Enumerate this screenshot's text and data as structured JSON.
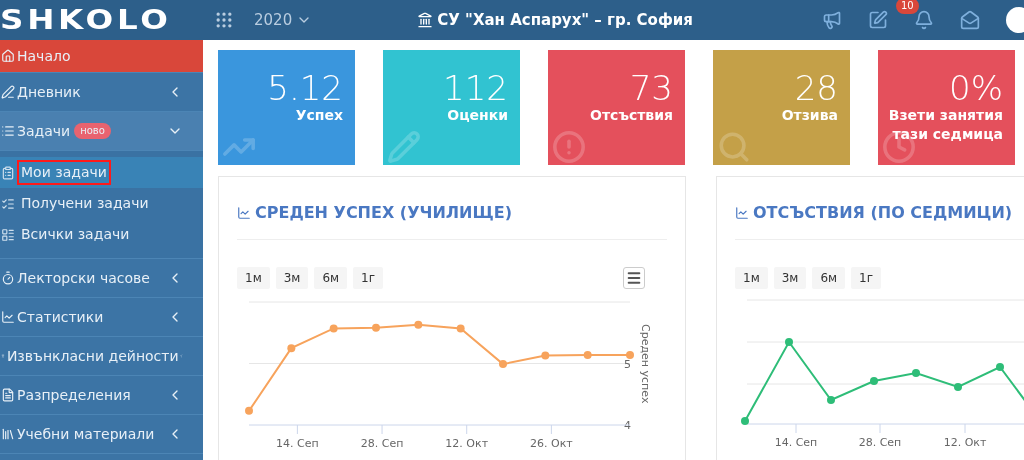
{
  "header": {
    "logo": "SHKOLO",
    "year": "2020",
    "school": "СУ \"Хан Аспарух\" – гр. София",
    "notification_count": "10"
  },
  "sidebar": {
    "items": [
      {
        "label": "Начало",
        "selected": true
      },
      {
        "label": "Дневник",
        "selected": false,
        "expanded": false
      },
      {
        "label": "Задачи",
        "badge": "ново",
        "selected": false,
        "expanded": true,
        "children": [
          {
            "label": "Мои задачи",
            "selected": true
          },
          {
            "label": "Получени задачи",
            "selected": false
          },
          {
            "label": "Всички задачи",
            "selected": false
          }
        ]
      },
      {
        "label": "Лекторски часове",
        "selected": false,
        "expanded": false
      },
      {
        "label": "Статистики",
        "selected": false,
        "expanded": false
      },
      {
        "label": "Извънкласни дейности",
        "selected": false,
        "expanded": false
      },
      {
        "label": "Разпределения",
        "selected": false,
        "expanded": false
      },
      {
        "label": "Учебни материали",
        "selected": false,
        "expanded": false
      }
    ]
  },
  "stat_cards": [
    {
      "value": "5.12",
      "label": "Успех",
      "color": "#3a96dd"
    },
    {
      "value": "112",
      "label": "Оценки",
      "color": "#31c3d1"
    },
    {
      "value": "73",
      "label": "Отсъствия",
      "color": "#e4505c"
    },
    {
      "value": "28",
      "label": "Отзива",
      "color": "#c4a048"
    },
    {
      "value": "0%",
      "label": "Взети занятия тази седмица",
      "color": "#e4505c"
    }
  ],
  "panels": [
    {
      "title": "СРЕДЕН УСПЕХ (УЧИЛИЩЕ)",
      "range_buttons": [
        "1м",
        "3м",
        "6м",
        "1г"
      ],
      "chart_data": {
        "type": "line",
        "ylabel": "Среден успех",
        "x": [
          "2020-09-06",
          "2020-09-13",
          "2020-09-20",
          "2020-09-27",
          "2020-10-04",
          "2020-10-11",
          "2020-10-18",
          "2020-10-25",
          "2020-11-01",
          "2020-11-08"
        ],
        "series": [
          {
            "color": "#f7a35c",
            "marker": true,
            "values": [
              4.23,
              5.25,
              5.57,
              5.58,
              5.63,
              5.57,
              4.99,
              5.13,
              5.14,
              5.14
            ]
          }
        ],
        "xlim": [
          "2020-09-06",
          "2020-11-08"
        ],
        "ylim": [
          4,
          6
        ],
        "xticks": [
          {
            "value": "2020-09-14",
            "label": "14. Сеп"
          },
          {
            "value": "2020-09-28",
            "label": "28. Сеп"
          },
          {
            "value": "2020-10-12",
            "label": "12. Окт"
          },
          {
            "value": "2020-10-26",
            "label": "26. Окт"
          }
        ],
        "yticks": [
          4,
          5
        ]
      }
    },
    {
      "title": "ОТСЪСТВИЯ (ПО СЕДМИЦИ)",
      "range_buttons": [
        "1м",
        "3м",
        "6м",
        "1г"
      ],
      "x_labels": [
        "14. Сеп",
        "28. Сеп",
        "12. Окт"
      ]
    }
  ]
}
